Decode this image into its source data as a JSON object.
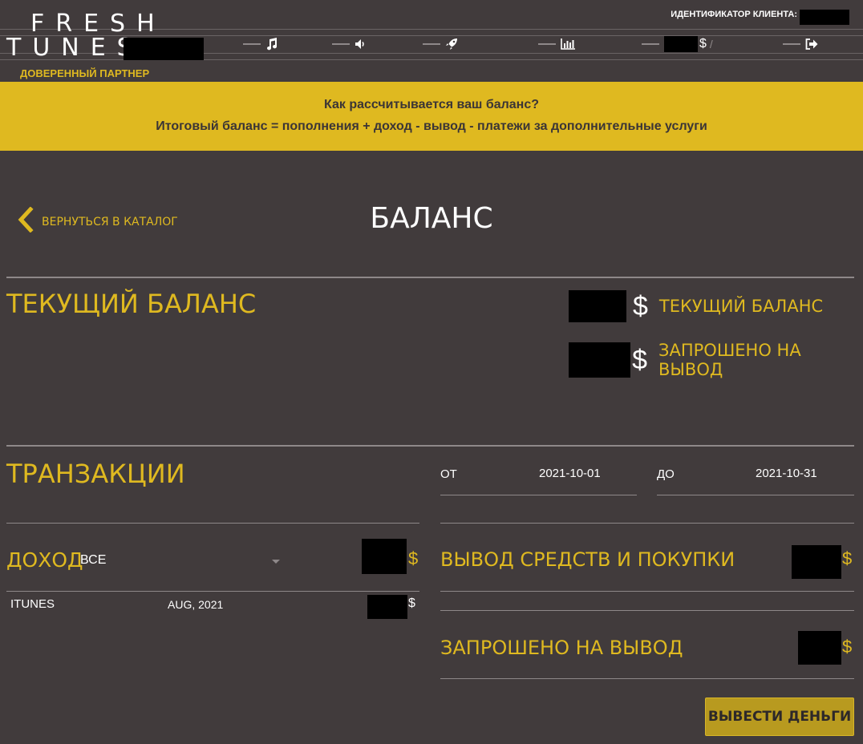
{
  "header": {
    "logo_row1": "FRESH",
    "logo_row2": "TUNES",
    "partner_label": "ДОВЕРЕННЫЙ ПАРТНЕР",
    "client_id_label": "ИДЕНТИФИКАТОР КЛИЕНТА:",
    "nav_balance_currency": "$",
    "nav_balance_slash": "/",
    "nav_icons": [
      "music-icon",
      "volume-icon",
      "rocket-icon",
      "bar-chart-icon",
      "balance",
      "logout-icon"
    ]
  },
  "banner": {
    "title": "Как рассчитывается ваш баланс?",
    "formula": "Итоговый баланс = пополнения + доход - вывод - платежи за дополнительные услуги"
  },
  "page": {
    "back_label": "ВЕРНУТЬСЯ В КАТАЛОГ",
    "title": "БАЛАНС"
  },
  "balance": {
    "section_title": "ТЕКУЩИЙ БАЛАНС",
    "currency": "$",
    "current_label": "ТЕКУЩИЙ БАЛАНС",
    "requested_label": "ЗАПРОШЕНО НА ВЫВОД"
  },
  "transactions": {
    "section_title": "ТРАНЗАКЦИИ",
    "from_label": "ОТ",
    "from_value": "2021-10-01",
    "to_label": "ДО",
    "to_value": "2021-10-31",
    "income": {
      "title": "ДОХОД",
      "filter_value": "ВСЕ",
      "currency": "$",
      "rows": [
        {
          "source": "ITUNES",
          "period": "AUG, 2021",
          "currency": "$"
        }
      ]
    },
    "withdrawals": {
      "title": "ВЫВОД СРЕДСТВ И ПОКУПКИ",
      "currency": "$"
    },
    "requested": {
      "title": "ЗАПРОШЕНО НА ВЫВОД",
      "currency": "$"
    },
    "withdraw_button": "ВЫВЕСТИ ДЕНЬГИ"
  },
  "colors": {
    "background": "#413b3c",
    "accent": "#dfb920",
    "button": "#b89a1f"
  }
}
